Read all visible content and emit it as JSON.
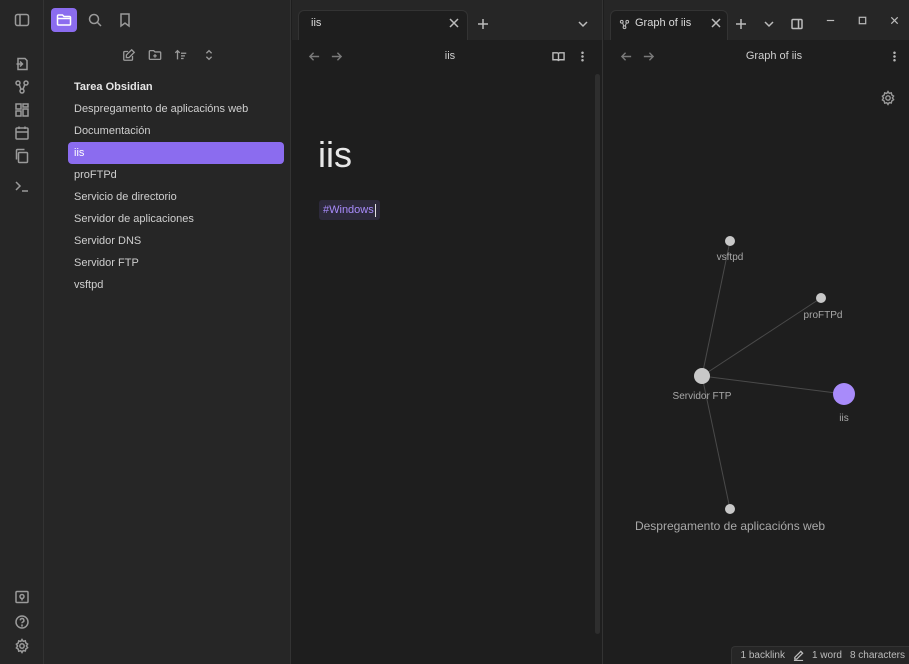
{
  "app": {
    "accent_color": "#8b6cef",
    "background_color": "#1e1e1e"
  },
  "ribbon": {
    "icons": [
      "sidebar-toggle-icon",
      "open-quick-switcher-icon",
      "graph-view-icon",
      "canvas-icon",
      "daily-notes-icon",
      "templates-icon",
      "terminal-icon"
    ],
    "bottom_icons": [
      "vault-switch-icon",
      "help-icon",
      "settings-icon"
    ]
  },
  "sidebar": {
    "tabs": [
      "files-tab",
      "search-tab",
      "bookmarks-tab"
    ],
    "actions": [
      "new-note-icon",
      "new-folder-icon",
      "sort-icon",
      "collapse-all-icon"
    ],
    "root": "Tarea Obsidian",
    "files": [
      {
        "label": "Despregamento de aplicacións web",
        "active": false
      },
      {
        "label": "Documentación",
        "active": false
      },
      {
        "label": "iis",
        "active": true
      },
      {
        "label": "proFTPd",
        "active": false
      },
      {
        "label": "Servicio de directorio",
        "active": false
      },
      {
        "label": "Servidor de aplicaciones",
        "active": false
      },
      {
        "label": "Servidor DNS",
        "active": false
      },
      {
        "label": "Servidor FTP",
        "active": false
      },
      {
        "label": "vsftpd",
        "active": false
      }
    ]
  },
  "editor": {
    "tab_title": "iis",
    "view_title": "iis",
    "note_title": "iis",
    "tag": "#Windows"
  },
  "graph": {
    "tab_title": "Graph of iis",
    "view_title": "Graph of iis",
    "nodes": [
      {
        "label": "vsftpd",
        "color": "#c8c8c8"
      },
      {
        "label": "proFTPd",
        "color": "#c8c8c8"
      },
      {
        "label": "Servidor FTP",
        "color": "#c8c8c8"
      },
      {
        "label": "iis",
        "color": "#a88bfa"
      },
      {
        "label": "Despregamento de aplicacións web",
        "color": "#c8c8c8"
      }
    ],
    "edges": [
      [
        "Servidor FTP",
        "vsftpd"
      ],
      [
        "Servidor FTP",
        "proFTPd"
      ],
      [
        "Servidor FTP",
        "iis"
      ],
      [
        "Servidor FTP",
        "Despregamento de aplicacións web"
      ]
    ]
  },
  "status": {
    "backlinks": "1 backlink",
    "words": "1 word",
    "characters": "8 characters"
  }
}
